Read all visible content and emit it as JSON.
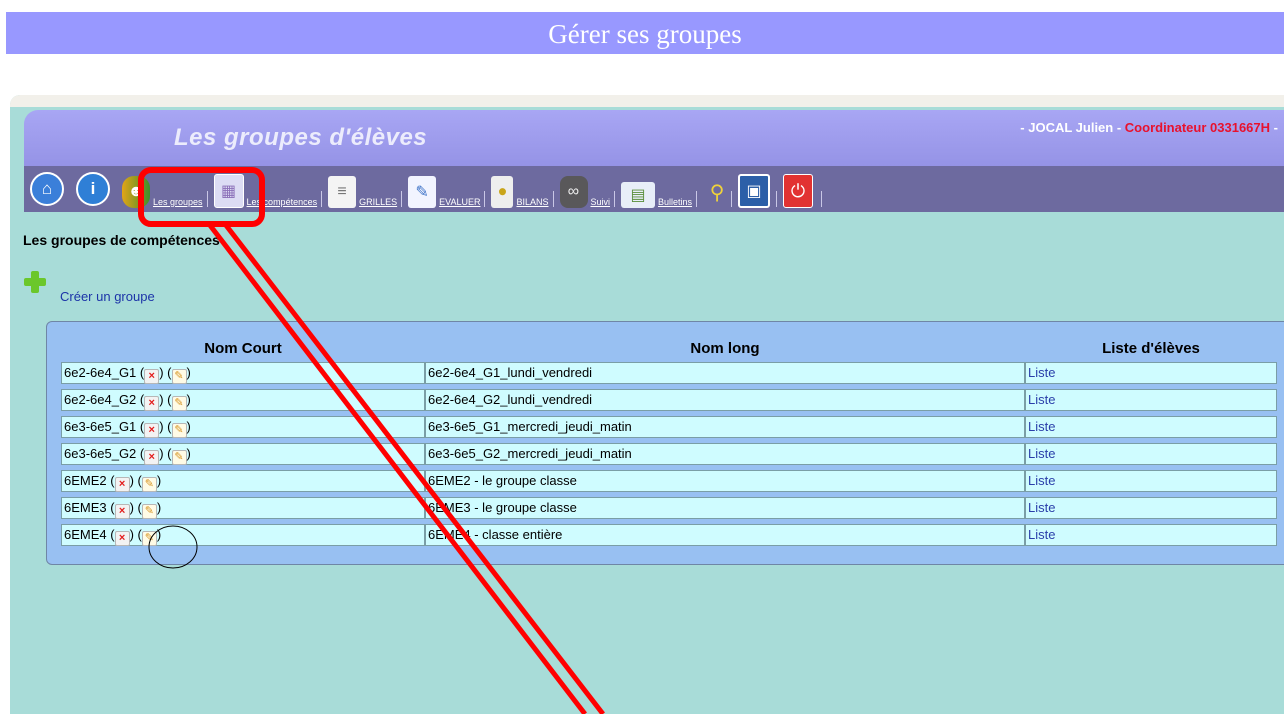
{
  "page_title": "Gérer ses groupes",
  "header": {
    "app_title": "Les groupes d'élèves",
    "user_prefix": "- JOCAL Julien -",
    "user_role": "Coordinateur 0331667H",
    "user_suffix": "-"
  },
  "toolbar": {
    "home_icon": "home-icon",
    "info_icon": "info-icon",
    "groups_label": "Les groupes",
    "competences_label": "Les compétences",
    "grilles_label": "GRILLES",
    "evaluer_label": "EVALUER",
    "bilans_label": "BILANS",
    "suivi_label": "Suivi",
    "bulletins_label": "Bulletins"
  },
  "section": {
    "title": "Les groupes de compétences",
    "create_label": "Créer un groupe"
  },
  "table": {
    "headers": [
      "Nom Court",
      "Nom long",
      "Liste d'élèves"
    ],
    "link_label": "Liste",
    "rows": [
      {
        "short": "6e2-6e4_G1",
        "long": "6e2-6e4_G1_lundi_vendredi"
      },
      {
        "short": "6e2-6e4_G2",
        "long": "6e2-6e4_G2_lundi_vendredi"
      },
      {
        "short": "6e3-6e5_G1",
        "long": "6e3-6e5_G1_mercredi_jeudi_matin"
      },
      {
        "short": "6e3-6e5_G2",
        "long": "6e3-6e5_G2_mercredi_jeudi_matin"
      },
      {
        "short": "6EME2",
        "long": "6EME2 - le groupe classe"
      },
      {
        "short": "6EME3",
        "long": "6EME3 - le groupe classe"
      },
      {
        "short": "6EME4",
        "long": "6EME4 - classe entière"
      }
    ]
  },
  "colors": {
    "banner": "#9898ff",
    "header": "#9b99ea",
    "toolbar": "#6d6a9f",
    "app_background": "#a8dcd8",
    "annotation": "#ff0000",
    "role_text": "#e8112d"
  }
}
